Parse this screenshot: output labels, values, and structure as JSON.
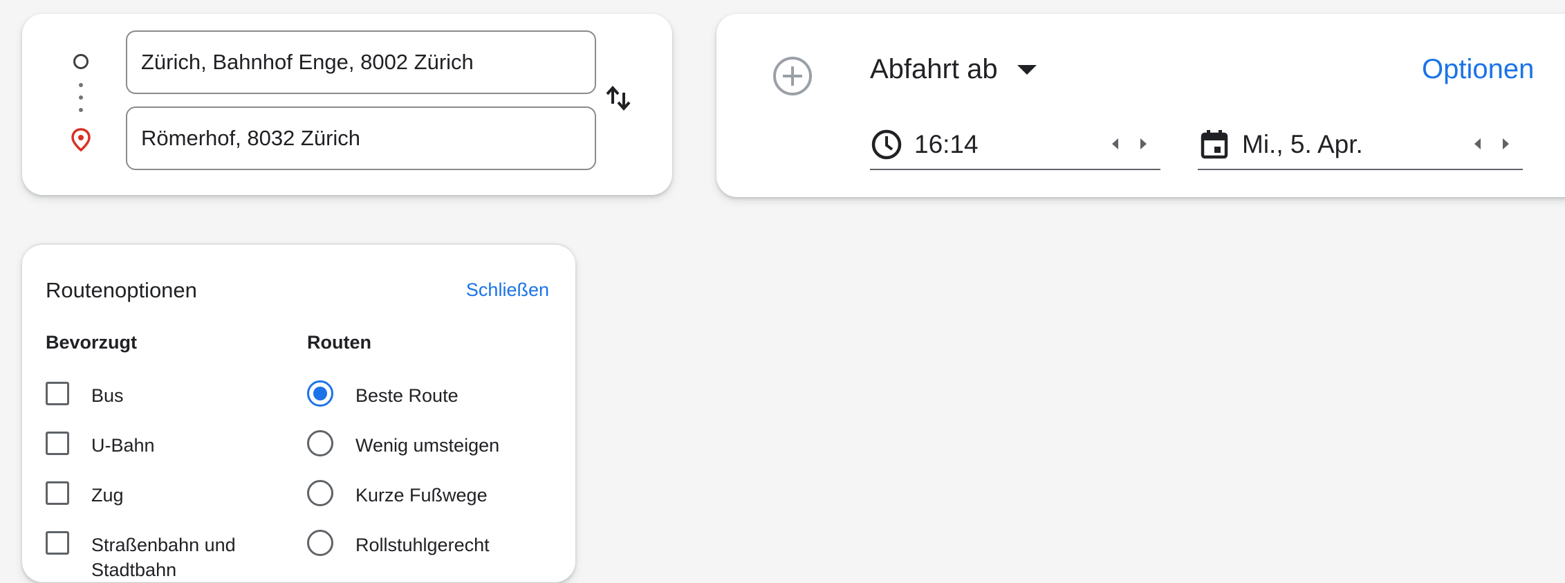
{
  "directions": {
    "origin": "Zürich, Bahnhof Enge, 8002 Zürich",
    "destination": "Römerhof, 8032 Zürich",
    "origin_icon": "circle-origin-icon",
    "destination_icon": "location-pin-icon",
    "swap_icon": "swap-vertical-icon"
  },
  "time": {
    "mode_label": "Abfahrt ab",
    "options_label": "Optionen",
    "time_value": "16:14",
    "date_value": "Mi., 5. Apr.",
    "add_icon": "add-circle-icon",
    "clock_icon": "clock-icon",
    "calendar_icon": "calendar-icon"
  },
  "route_options": {
    "title": "Routenoptionen",
    "close_label": "Schließen",
    "preferred": {
      "heading": "Bevorzugt",
      "items": [
        {
          "label": "Bus",
          "checked": false
        },
        {
          "label": "U-Bahn",
          "checked": false
        },
        {
          "label": "Zug",
          "checked": false
        },
        {
          "label": "Straßenbahn und Stadtbahn",
          "checked": false
        }
      ]
    },
    "routes": {
      "heading": "Routen",
      "items": [
        {
          "label": "Beste Route",
          "selected": true
        },
        {
          "label": "Wenig umsteigen",
          "selected": false
        },
        {
          "label": "Kurze Fußwege",
          "selected": false
        },
        {
          "label": "Rollstuhlgerecht",
          "selected": false
        }
      ]
    }
  },
  "colors": {
    "accent": "#1a73e8",
    "destination_pin": "#d93025"
  }
}
